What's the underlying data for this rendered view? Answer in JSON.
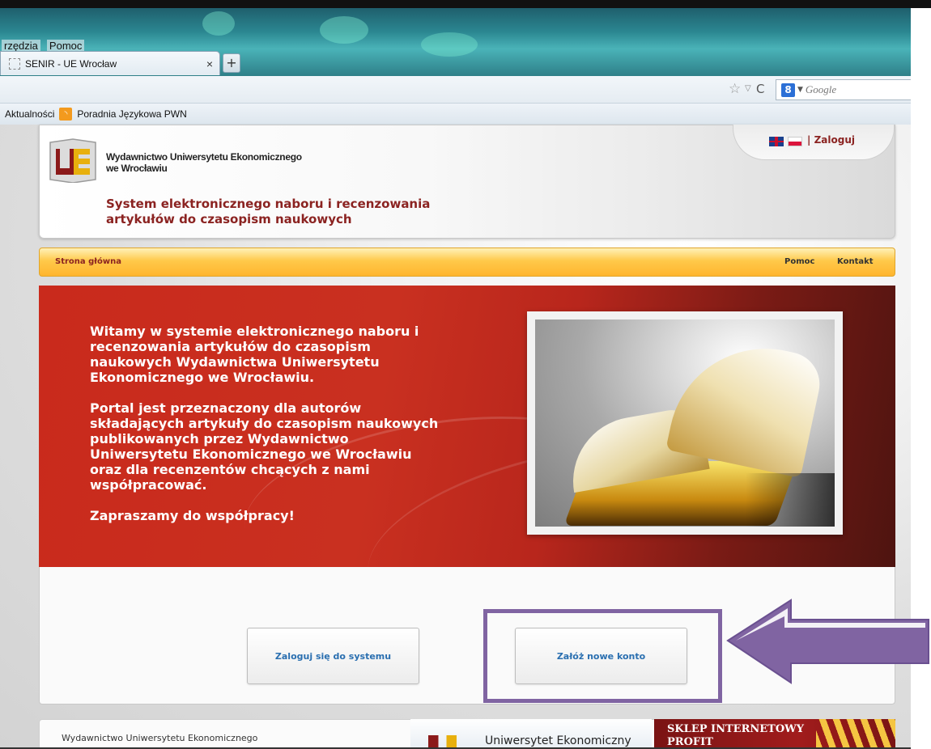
{
  "browser": {
    "menu": [
      "rzędzia",
      "Pomoc"
    ],
    "tab_title": "SENIR - UE Wrocław",
    "tab_close": "×",
    "new_tab": "+",
    "search_placeholder": "Google",
    "bookmarks": [
      "Aktualności",
      "Poradnia Językowa PWN"
    ]
  },
  "header": {
    "publisher_line1": "Wydawnictwo Uniwersytetu Ekonomicznego",
    "publisher_line2": "we Wrocławiu",
    "title_line1": "System elektronicznego naboru i recenzowania",
    "title_line2": "artykułów do czasopism naukowych",
    "login_separator": "|",
    "login_link": "Zaloguj"
  },
  "nav": {
    "home": "Strona główna",
    "help": "Pomoc",
    "contact": "Kontakt"
  },
  "banner": {
    "paragraph1": "Witamy w systemie elektronicznego naboru i recenzowania artykułów do czasopism naukowych Wydawnictwa Uniwersytetu Ekonomicznego we Wrocławiu.",
    "paragraph2": "Portal jest przeznaczony dla autorów składających artykuły do czasopism naukowych publikowanych przez Wydawnictwo Uniwersytetu Ekonomicznego we Wrocławiu oraz dla recenzentów chcących z nami współpracować.",
    "paragraph3": "Zapraszamy do współpracy!"
  },
  "actions": {
    "login_button": "Zaloguj się do systemu",
    "register_button": "Załóż nowe konto"
  },
  "footer": {
    "left_text": "Wydawnictwo Uniwersytetu Ekonomicznego",
    "ue_text": "Uniwersytet Ekonomiczny",
    "shop_line1": "SKLEP INTERNETOWY",
    "shop_line2": "PROFIT"
  },
  "colors": {
    "accent_red": "#8b2321",
    "banner_red": "#c92a1c",
    "nav_orange": "#ffb52e",
    "highlight_purple": "#8064a2",
    "link_blue": "#2a6fb0"
  }
}
